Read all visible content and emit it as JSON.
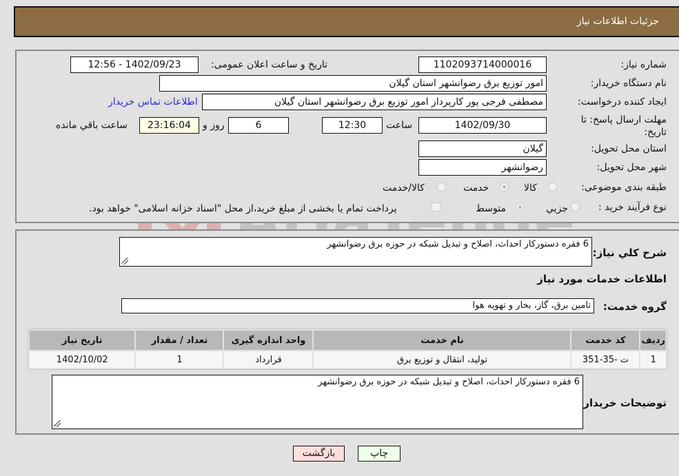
{
  "header": {
    "title": "جزئیات اطلاعات نیاز"
  },
  "form": {
    "need_number": {
      "label": "شماره نیاز:",
      "value": "1102093714000016"
    },
    "announce_datetime": {
      "label": "تاریخ و ساعت اعلان عمومی:",
      "value": "1402/09/23 - 12:56"
    },
    "buyer_org": {
      "label": "نام دستگاه خریدار:",
      "value": "امور توزیع برق رضوانشهر استان گیلان"
    },
    "requester": {
      "label": "ایجاد کننده درخواست:",
      "value": "مصطفی فرجی پور کارپرداز امور توزیع برق رضوانشهر استان گیلان"
    },
    "buyer_contact_link": "اطلاعات تماس خریدار",
    "deadline": {
      "label": "مهلت ارسال پاسخ: تا تاریخ:",
      "date": "1402/09/30",
      "time_label": "ساعت",
      "time": "12:30",
      "days": "6",
      "days_label": "روز و",
      "remaining": "23:16:04",
      "remaining_label": "ساعت باقي مانده"
    },
    "province": {
      "label": "استان محل تحویل:",
      "value": "گیلان"
    },
    "city": {
      "label": "شهر محل تحویل:",
      "value": "رضوانشهر"
    },
    "category": {
      "label": "طبقه بندی موضوعی:",
      "options": [
        "کالا",
        "خدمت",
        "کالا/خدمت"
      ],
      "selected": "خدمت"
    },
    "process_type": {
      "label": "نوع فرآیند خرید :",
      "options": [
        "جزيي",
        "متوسط"
      ],
      "selected": "متوسط",
      "payment_note": "پرداخت تمام یا بخشی از مبلغ خرید،از محل \"اسناد خزانه اسلامی\" خواهد بود."
    }
  },
  "description": {
    "label": "شرح کلي نیاز:",
    "value": "6 فقره دستورکار احداث، اصلاح و تبدیل شبکه در حوزه برق رضوانشهر"
  },
  "services": {
    "section_title": "اطلاعات خدمات مورد نیاز",
    "group_label": "گروه خدمت:",
    "group_value": "تامین برق، گاز، بخار و تهویه هوا",
    "columns": [
      "ردیف",
      "کد خدمت",
      "نام خدمت",
      "واحد اندازه گیری",
      "تعداد / مقدار",
      "تاریخ نیاز"
    ],
    "rows": [
      [
        "1",
        "ت -35-351",
        "تولید، انتقال و توزیع برق",
        "قرارداد",
        "1",
        "1402/10/02"
      ]
    ]
  },
  "buyer_notes": {
    "label": "توضیحات خریدار:",
    "value": "6 فقره دستورکار احداث، اصلاح و تبدیل شبکه در حوزه برق رضوانشهر"
  },
  "buttons": {
    "print": "چاپ",
    "back": "بازگشت"
  },
  "colors": {
    "header": "#8c6c43",
    "print_bg": "#efffea",
    "back_bg": "#ffdede",
    "link": "#2b2bd0"
  }
}
